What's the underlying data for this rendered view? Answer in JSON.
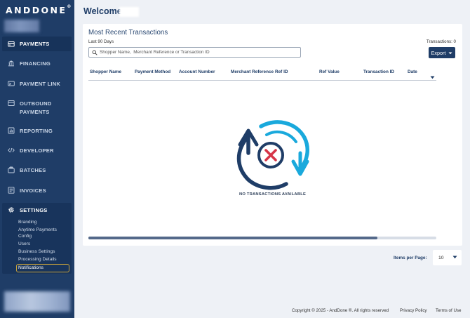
{
  "brand": {
    "logo": "ANDDONE",
    "registered": "®"
  },
  "sidebar": {
    "items": [
      {
        "label": "PAYMENTS",
        "icon": "payments-icon",
        "active": true
      },
      {
        "label": "FINANCING",
        "icon": "bank-icon"
      },
      {
        "label": "PAYMENT LINK",
        "icon": "payment-link-icon"
      },
      {
        "label_line1": "OUTBOUND",
        "label_line2": "PAYMENTS",
        "icon": "outbound-payments-icon"
      },
      {
        "label": "REPORTING",
        "icon": "reporting-icon"
      },
      {
        "label": "DEVELOPER",
        "icon": "code-icon"
      },
      {
        "label": "BATCHES",
        "icon": "batches-icon"
      },
      {
        "label": "INVOICES",
        "icon": "invoices-icon"
      }
    ],
    "settings": {
      "label": "SETTINGS",
      "icon": "gear-icon",
      "subitems": [
        {
          "label": "Branding"
        },
        {
          "label_line1": "Anytime Payments",
          "label_line2": "Config"
        },
        {
          "label": "Users"
        },
        {
          "label": "Business Settings"
        },
        {
          "label": "Processing Details"
        },
        {
          "label": "Notifications",
          "active": true
        }
      ]
    }
  },
  "header": {
    "welcome": "Welcome,"
  },
  "transactions": {
    "title": "Most Recent Transactions",
    "period": "Last 90 Days",
    "count_text": "Transactions: 0",
    "search_placeholder": "Shopper Name,  Merchant Reference or Transaction ID",
    "export_label": "Export",
    "columns": [
      "Shopper Name",
      "Payment Method",
      "Account Number",
      "Merchant Reference",
      "Ref ID",
      "Ref Value",
      "Transaction ID",
      "Date"
    ],
    "empty_message": "NO TRANSACTIONS AVAILABLE",
    "scroll_position": 0.83
  },
  "pagination": {
    "label": "Items per Page:",
    "value": "10"
  },
  "footer": {
    "copyright": "Copyright © 2025 - AndDone ®. All rights reserved",
    "privacy": "Privacy Policy",
    "terms": "Terms of Use"
  },
  "colors": {
    "sidebar_bg": "#1f3d67",
    "page_bg": "#eef1f6",
    "accent_blue": "#1aa9dc",
    "navy": "#1f3d67",
    "error_red": "#d63447",
    "active_border": "#c9a33b"
  }
}
